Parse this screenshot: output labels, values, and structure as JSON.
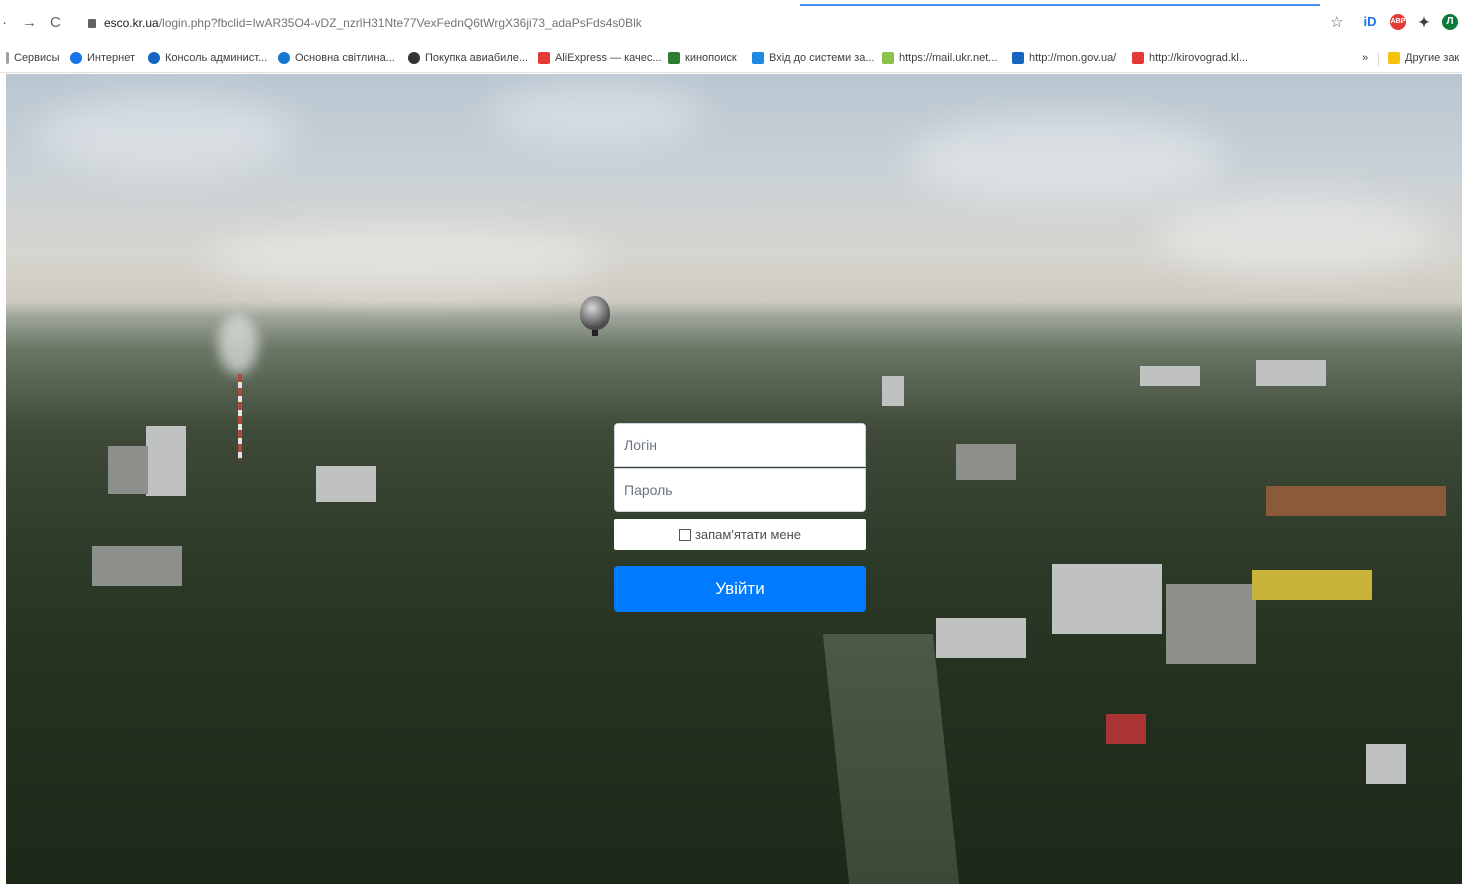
{
  "browser": {
    "url_host": "esco.kr.ua",
    "url_path": "/login.php?fbclid=IwAR35O4-vDZ_nzrlH31Nte77VexFednQ6tWrgX36ji73_adaPsFds4s0Blk",
    "extensions": [
      {
        "name": "Ɨ D",
        "color": "#1a73e8",
        "label": "iD"
      },
      {
        "name": "adblock",
        "color": "#e53935",
        "label": "ABP"
      },
      {
        "name": "extensions",
        "color": "#202124",
        "label": "✦"
      },
      {
        "name": "profile",
        "color": "#0b7a3b",
        "label": "Л"
      }
    ]
  },
  "bookmarks": [
    {
      "label": "Сервисы",
      "color": "#9aa0a6"
    },
    {
      "label": "Интернет",
      "color": "#1a73e8"
    },
    {
      "label": "Консоль админист...",
      "color": "#1565c0"
    },
    {
      "label": "Основна світлина...",
      "color": "#1976d2"
    },
    {
      "label": "Покупка авиабиле...",
      "color": "#333333"
    },
    {
      "label": "AliExpress — качес...",
      "color": "#e53935"
    },
    {
      "label": "кинопоиск",
      "color": "#2e7d32"
    },
    {
      "label": "Вхід до системи за...",
      "color": "#1e88e5"
    },
    {
      "label": "https://mail.ukr.net...",
      "color": "#8bc34a"
    },
    {
      "label": "http://mon.gov.ua/",
      "color": "#1565c0"
    },
    {
      "label": "http://kirovograd.kl...",
      "color": "#e53935"
    }
  ],
  "bookmarks_more": "»",
  "bookmarks_other": "Другие зак",
  "login": {
    "login_placeholder": "Логін",
    "password_placeholder": "Пароль",
    "remember_label": "запам'ятати мене",
    "submit_label": "Увійти",
    "accent": "#007bff"
  }
}
